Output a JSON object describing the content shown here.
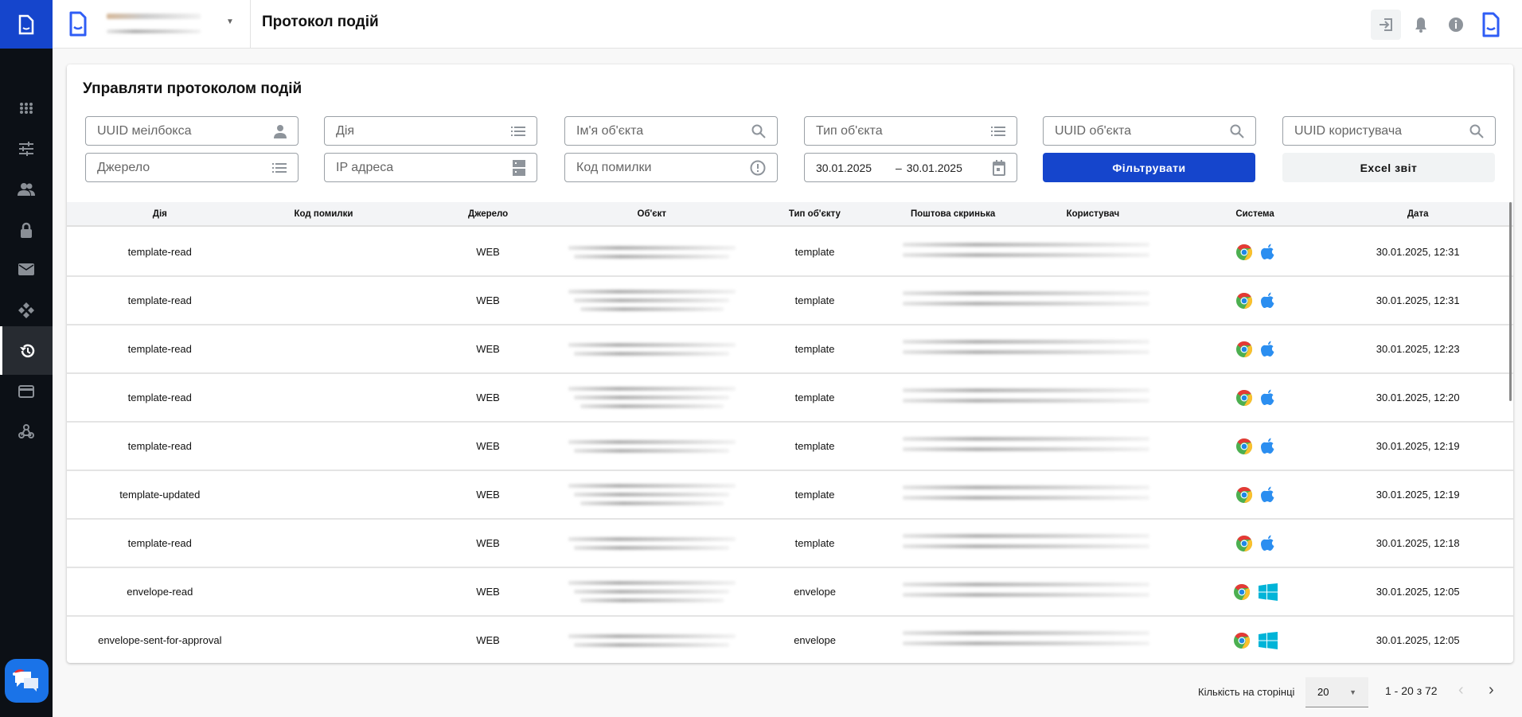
{
  "header": {
    "title": "Протокол подій"
  },
  "page": {
    "title": "Управляти протоколом подій"
  },
  "filters": {
    "mailbox_uuid": "UUID меілбокса",
    "action": "Дія",
    "object_name": "Ім'я об'єкта",
    "object_type": "Тип об'єкта",
    "object_uuid": "UUID об'єкта",
    "user_uuid": "UUID користувача",
    "source": "Джерело",
    "ip": "IP адреса",
    "error_code": "Код помилки",
    "date_from": "30.01.2025",
    "date_sep": "–",
    "date_to": "30.01.2025",
    "filter_button": "Фільтрувати",
    "excel_button": "Excel звіт"
  },
  "table": {
    "columns": [
      "Дія",
      "Код помилки",
      "Джерело",
      "Об'єкт",
      "Тип об'єкту",
      "Поштова скринька",
      "Користувач",
      "Система",
      "Дата"
    ],
    "rows": [
      {
        "action": "template-read",
        "error": "",
        "source": "WEB",
        "type": "template",
        "browser": "chrome",
        "os": "apple",
        "date": "30.01.2025, 12:31"
      },
      {
        "action": "template-read",
        "error": "",
        "source": "WEB",
        "type": "template",
        "browser": "chrome",
        "os": "apple",
        "date": "30.01.2025, 12:31"
      },
      {
        "action": "template-read",
        "error": "",
        "source": "WEB",
        "type": "template",
        "browser": "chrome",
        "os": "apple",
        "date": "30.01.2025, 12:23"
      },
      {
        "action": "template-read",
        "error": "",
        "source": "WEB",
        "type": "template",
        "browser": "chrome",
        "os": "apple",
        "date": "30.01.2025, 12:20"
      },
      {
        "action": "template-read",
        "error": "",
        "source": "WEB",
        "type": "template",
        "browser": "chrome",
        "os": "apple",
        "date": "30.01.2025, 12:19"
      },
      {
        "action": "template-updated",
        "error": "",
        "source": "WEB",
        "type": "template",
        "browser": "chrome",
        "os": "apple",
        "date": "30.01.2025, 12:19"
      },
      {
        "action": "template-read",
        "error": "",
        "source": "WEB",
        "type": "template",
        "browser": "chrome",
        "os": "apple",
        "date": "30.01.2025, 12:18"
      },
      {
        "action": "envelope-read",
        "error": "",
        "source": "WEB",
        "type": "envelope",
        "browser": "chrome",
        "os": "windows",
        "date": "30.01.2025, 12:05"
      },
      {
        "action": "envelope-sent-for-approval",
        "error": "",
        "source": "WEB",
        "type": "envelope",
        "browser": "chrome",
        "os": "windows",
        "date": "30.01.2025, 12:05"
      }
    ]
  },
  "pagination": {
    "per_page_label": "Кількість на сторінці",
    "per_page": "20",
    "range": "1 - 20 з 72"
  },
  "colors": {
    "brand": "#1545cc",
    "sidebar": "#0c1016"
  }
}
